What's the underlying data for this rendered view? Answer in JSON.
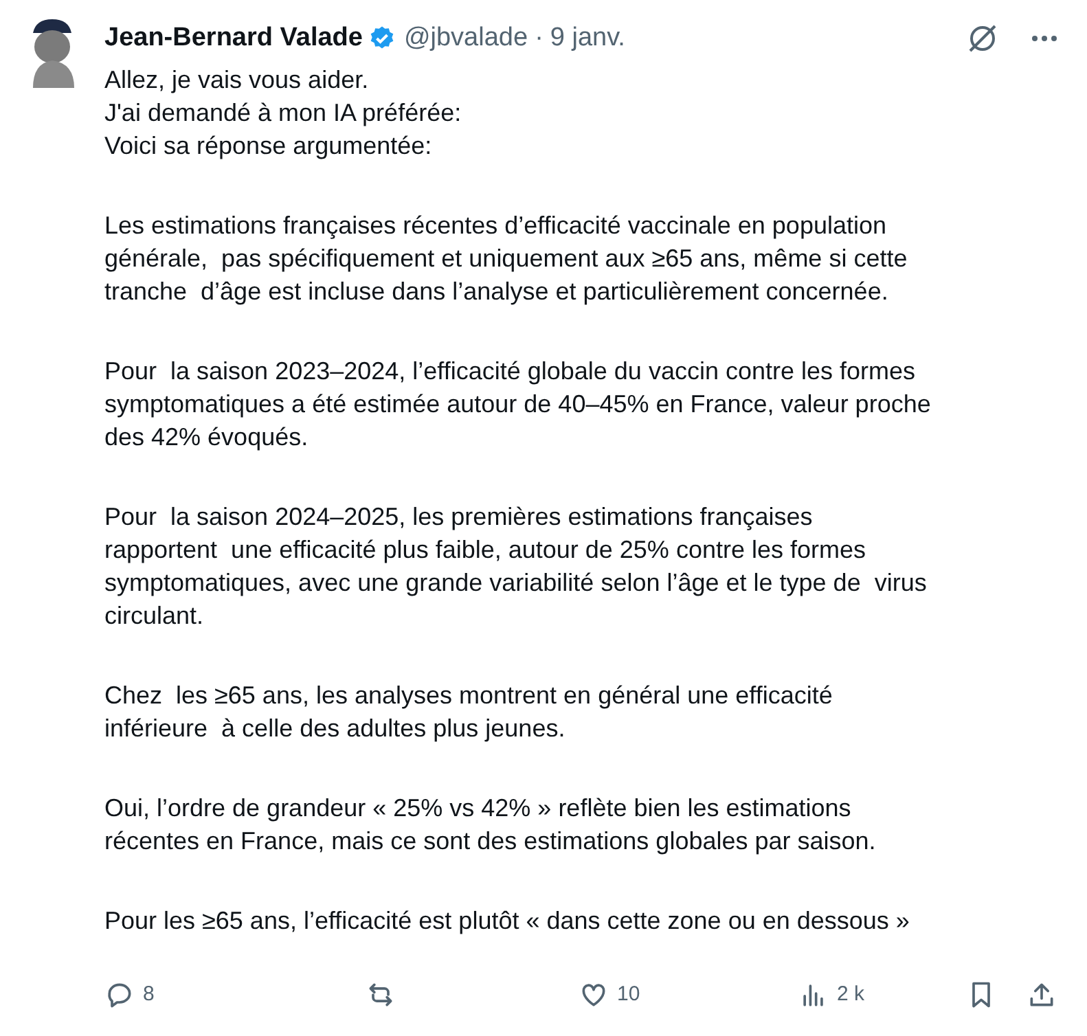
{
  "author": {
    "name": "Jean-Bernard Valade",
    "verified": true,
    "handle": "@jbvalade",
    "separator": "·",
    "date": "9 janv."
  },
  "paragraphs": [
    [
      "Allez, je vais vous aider.",
      "J'ai demandé à mon IA préférée:",
      "Voici sa réponse argumentée:"
    ],
    [
      "Les estimations françaises récentes d’efficacité vaccinale en population",
      "générale,  pas spécifiquement et uniquement aux ≥65 ans, même si cette",
      "tranche  d’âge est incluse dans l’analyse et particulièrement concernée."
    ],
    [
      "Pour  la saison 2023–2024, l’efficacité globale du vaccin contre les formes",
      "symptomatiques a été estimée autour de 40–45% en France, valeur proche",
      "des 42% évoqués."
    ],
    [
      "Pour  la saison 2024–2025, les premières estimations françaises",
      "rapportent  une efficacité plus faible, autour de 25% contre les formes",
      "symptomatiques, avec une grande variabilité selon l’âge et le type de  virus",
      "circulant."
    ],
    [
      "Chez  les ≥65 ans, les analyses montrent en général une efficacité",
      "inférieure  à celle des adultes plus jeunes."
    ],
    [
      "Oui, l’ordre de grandeur « 25% vs 42% » reflète bien les estimations",
      "récentes en France, mais ce sont des estimations globales par saison."
    ],
    [
      "Pour les ≥65 ans, l’efficacité est plutôt « dans cette zone ou en dessous »"
    ]
  ],
  "actions": [
    {
      "kind": "reply",
      "count": "8"
    },
    {
      "kind": "repost"
    },
    {
      "kind": "like",
      "count": "10"
    },
    {
      "kind": "views",
      "count": "2 k"
    }
  ]
}
